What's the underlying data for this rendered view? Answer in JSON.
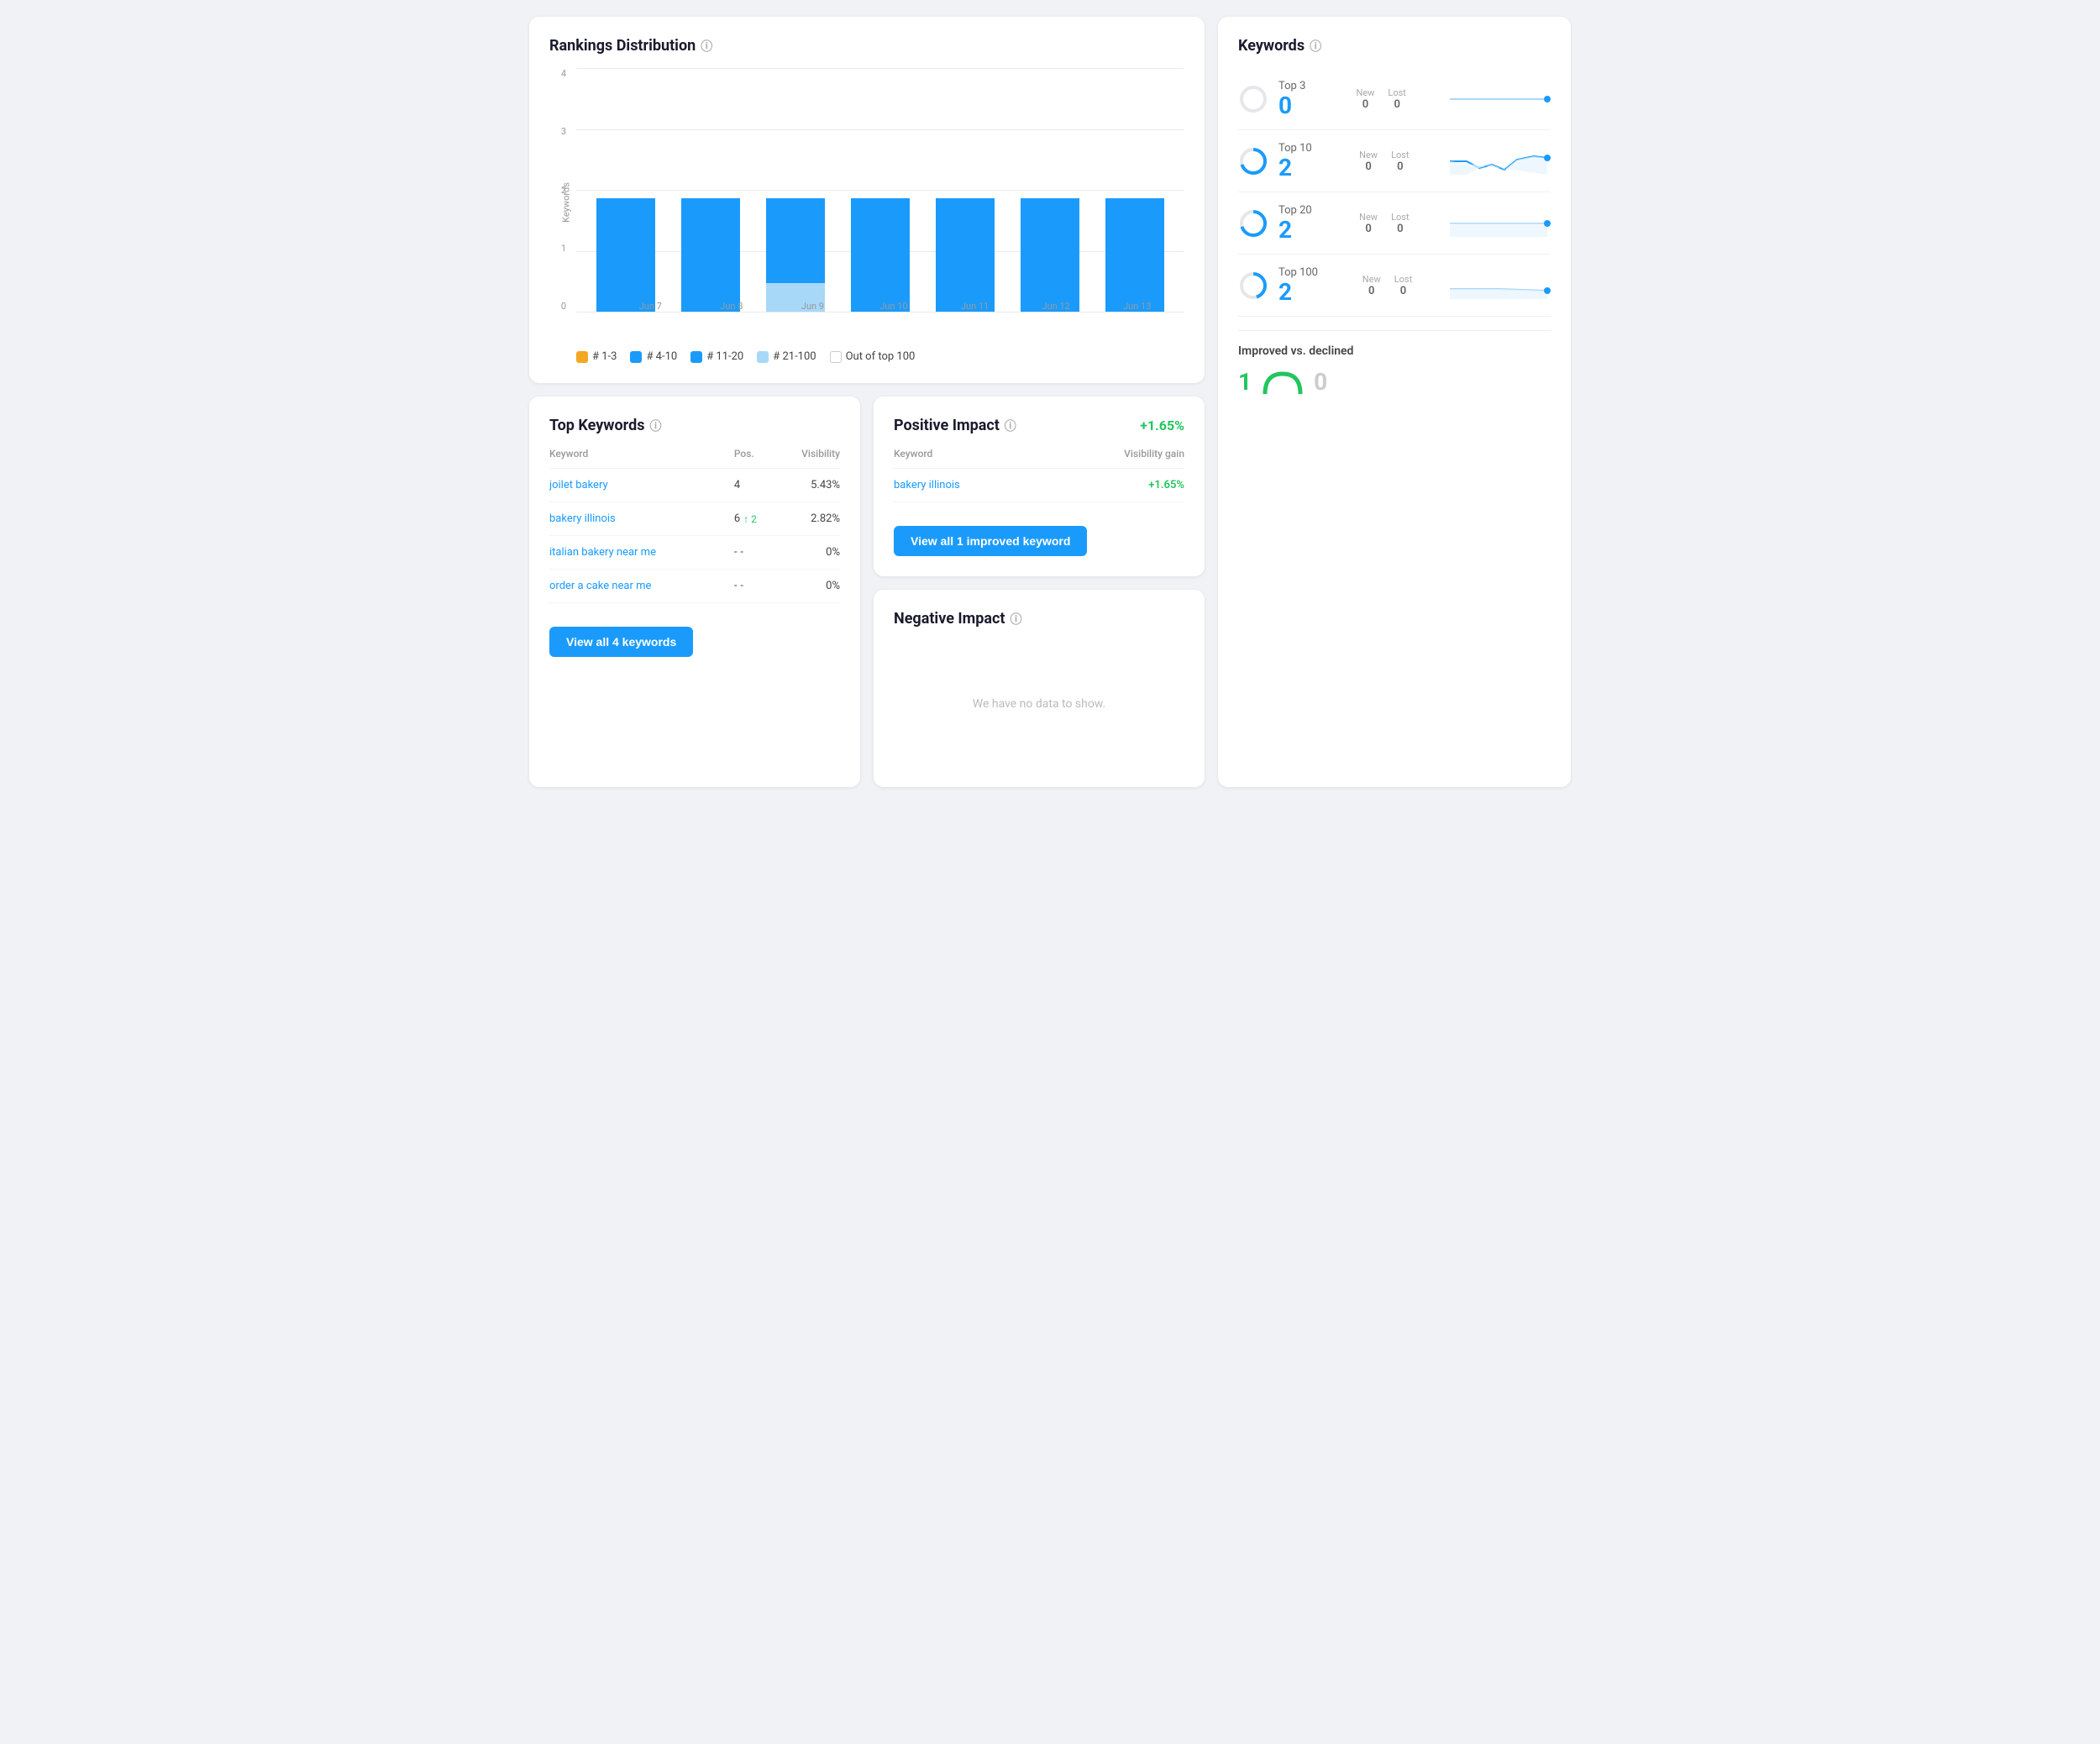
{
  "rankings_distribution": {
    "title": "Rankings Distribution",
    "y_labels": [
      "4",
      "3",
      "2",
      "1",
      "0"
    ],
    "x_labels": [
      "Jun 7",
      "Jun 8",
      "Jun 9",
      "Jun 10",
      "Jun 11",
      "Jun 12",
      "Jun 13"
    ],
    "y_axis_label": "Keywords",
    "legend": [
      {
        "label": "# 1-3",
        "color": "#f5a623",
        "checked": true
      },
      {
        "label": "# 4-10",
        "color": "#1a9bfc",
        "checked": true
      },
      {
        "label": "# 11-20",
        "color": "#1a9bfc",
        "checked": true
      },
      {
        "label": "# 21-100",
        "color": "#a8d8f8",
        "checked": true
      },
      {
        "label": "Out of top 100",
        "color": "#ffffff",
        "checked": false
      }
    ],
    "bars": [
      {
        "date": "Jun 7",
        "seg1": 0,
        "seg2": 2,
        "seg3": 0,
        "seg4": 0
      },
      {
        "date": "Jun 8",
        "seg1": 0,
        "seg2": 2,
        "seg3": 0,
        "seg4": 0
      },
      {
        "date": "Jun 9",
        "seg1": 0,
        "seg2": 1.5,
        "seg3": 0,
        "seg4": 0.5
      },
      {
        "date": "Jun 10",
        "seg1": 0,
        "seg2": 2,
        "seg3": 0,
        "seg4": 0
      },
      {
        "date": "Jun 11",
        "seg1": 0,
        "seg2": 2,
        "seg3": 0,
        "seg4": 0
      },
      {
        "date": "Jun 12",
        "seg1": 0,
        "seg2": 2,
        "seg3": 0,
        "seg4": 0
      },
      {
        "date": "Jun 13",
        "seg1": 0,
        "seg2": 2,
        "seg3": 0,
        "seg4": 0
      }
    ]
  },
  "keywords": {
    "title": "Keywords",
    "rows": [
      {
        "label": "Top 3",
        "count": "0",
        "new": "0",
        "lost": "0"
      },
      {
        "label": "Top 10",
        "count": "2",
        "new": "0",
        "lost": "0"
      },
      {
        "label": "Top 20",
        "count": "2",
        "new": "0",
        "lost": "0"
      },
      {
        "label": "Top 100",
        "count": "2",
        "new": "0",
        "lost": "0"
      }
    ],
    "new_label": "New",
    "lost_label": "Lost",
    "improved_section": {
      "title": "Improved vs. declined",
      "improved": "1",
      "declined": "0"
    }
  },
  "top_keywords": {
    "title": "Top Keywords",
    "col_keyword": "Keyword",
    "col_pos": "Pos.",
    "col_visibility": "Visibility",
    "rows": [
      {
        "keyword": "joilet bakery",
        "pos": "4",
        "pos_change": "0",
        "pos_dir": "none",
        "visibility": "5.43%"
      },
      {
        "keyword": "bakery illinois",
        "pos": "6",
        "pos_change": "2",
        "pos_dir": "up",
        "visibility": "2.82%"
      },
      {
        "keyword": "italian bakery near me",
        "pos": "-",
        "pos_change": "-",
        "pos_dir": "none",
        "visibility": "0%"
      },
      {
        "keyword": "order a cake near me",
        "pos": "-",
        "pos_change": "-",
        "pos_dir": "none",
        "visibility": "0%"
      }
    ],
    "btn_label": "View all 4 keywords"
  },
  "positive_impact": {
    "title": "Positive Impact",
    "total_value": "+1.65%",
    "col_keyword": "Keyword",
    "col_visibility_gain": "Visibility gain",
    "rows": [
      {
        "keyword": "bakery illinois",
        "gain": "+1.65%"
      }
    ],
    "btn_label": "View all 1 improved keyword"
  },
  "negative_impact": {
    "title": "Negative Impact",
    "no_data_text": "We have no data to show."
  }
}
